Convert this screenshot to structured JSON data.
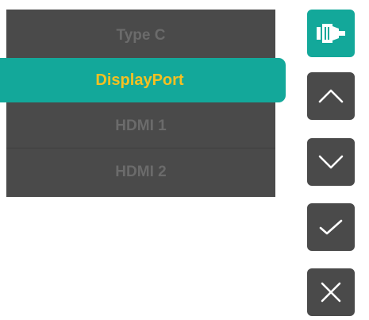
{
  "menu": {
    "items": [
      {
        "label": "Type C"
      },
      {
        "label": "DisplayPort"
      },
      {
        "label": "HDMI 1"
      },
      {
        "label": "HDMI 2"
      }
    ],
    "selected_index": 1
  },
  "controls": [
    {
      "name": "input-source-button",
      "icon": "input-connector-icon"
    },
    {
      "name": "up-button",
      "icon": "chevron-up-icon"
    },
    {
      "name": "down-button",
      "icon": "chevron-down-icon"
    },
    {
      "name": "confirm-button",
      "icon": "checkmark-icon"
    },
    {
      "name": "close-button",
      "icon": "close-icon"
    }
  ],
  "colors": {
    "accent": "#13a89a",
    "selected_text": "#f5c022",
    "panel": "#4a4a4a",
    "inactive_text": "#6b6b6b"
  }
}
